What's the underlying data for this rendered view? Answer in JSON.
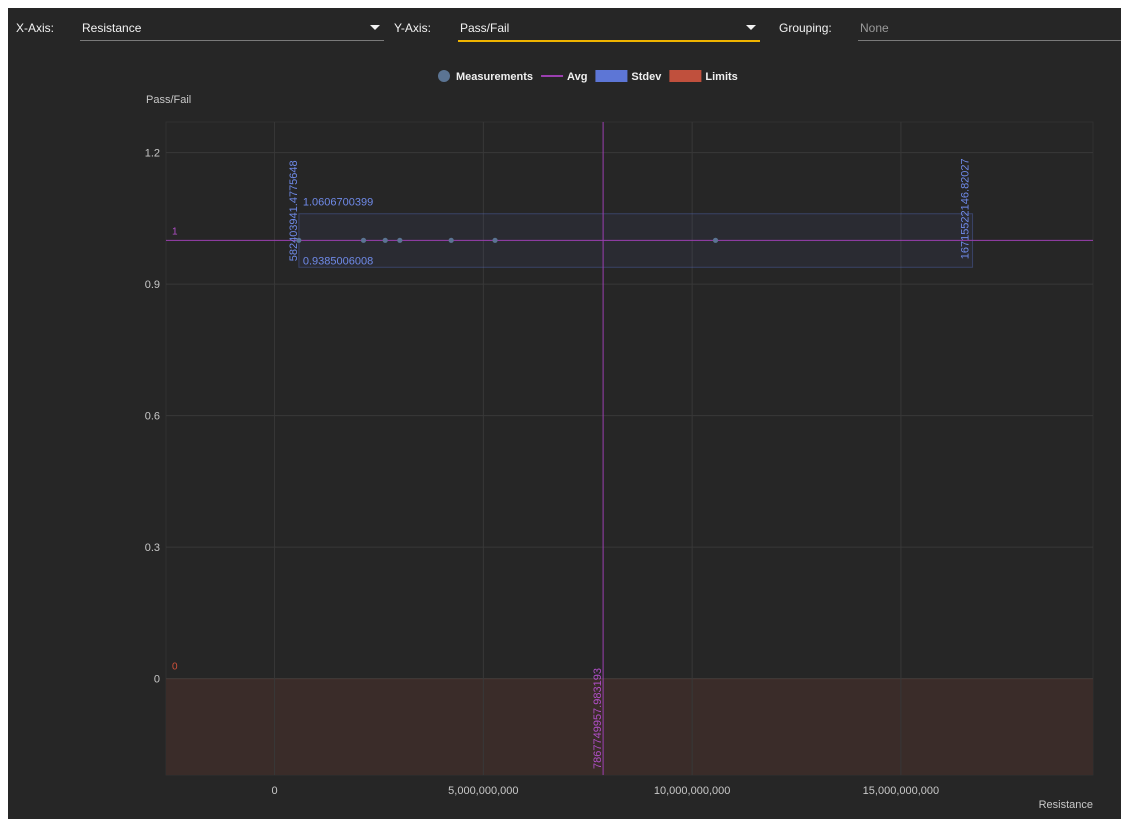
{
  "toolbar": {
    "x_axis_label": "X-Axis:",
    "x_axis_value": "Resistance",
    "y_axis_label": "Y-Axis:",
    "y_axis_value": "Pass/Fail",
    "grouping_label": "Grouping:",
    "grouping_value": "None"
  },
  "colors": {
    "background": "#262626",
    "measurement": "#5b7493",
    "avg": "#9b3fb0",
    "stdev": "#5d76d6",
    "limits": "#b04a3a",
    "accent": "#f0b400"
  },
  "chart_data": {
    "type": "scatter",
    "legend": {
      "placement": "top-center",
      "items": [
        {
          "label": "Measurements",
          "marker": "circle",
          "color": "#5b7493"
        },
        {
          "label": "Avg",
          "marker": "line",
          "color": "#9b3fb0"
        },
        {
          "label": "Stdev",
          "marker": "rect",
          "color": "#5d76d6"
        },
        {
          "label": "Limits",
          "marker": "rect",
          "color": "#c0503d"
        }
      ]
    },
    "ylabel": "Pass/Fail",
    "xlabel": "Resistance",
    "xlim": [
      -2600000000,
      19600000000
    ],
    "ylim": [
      -0.22,
      1.27
    ],
    "xticks": [
      0,
      5000000000,
      10000000000,
      15000000000
    ],
    "xtick_labels": [
      "0",
      "5,000,000,000",
      "10,000,000,000",
      "15,000,000,000"
    ],
    "yticks": [
      0,
      0.3,
      0.6,
      0.9,
      1.2
    ],
    "ytick_labels": [
      "0",
      "0.3",
      "0.6",
      "0.9",
      "1.2"
    ],
    "grid": true,
    "measurements": [
      {
        "x": 580000000,
        "y": 1
      },
      {
        "x": 2130000000,
        "y": 1
      },
      {
        "x": 2650000000,
        "y": 1
      },
      {
        "x": 3000000000,
        "y": 1
      },
      {
        "x": 4230000000,
        "y": 1
      },
      {
        "x": 5280000000,
        "y": 1
      },
      {
        "x": 10560000000,
        "y": 1
      }
    ],
    "avg_y": 1,
    "avg_y_label": "1",
    "avg_x": 7867749957.983193,
    "avg_x_label": "7867749957.983193",
    "stdev_y_upper": 1.0606700399,
    "stdev_y_upper_label": "1.0606700399",
    "stdev_y_lower": 0.9385006008,
    "stdev_y_lower_label": "0.9385006008",
    "stdev_x_lower": 582403941.4775648,
    "stdev_x_lower_label": "582403941.4775648",
    "stdev_x_upper": 16715522146.82027,
    "stdev_x_upper_label": "16715522146.82027",
    "limit_upper": 0,
    "limit_upper_label": "0"
  }
}
